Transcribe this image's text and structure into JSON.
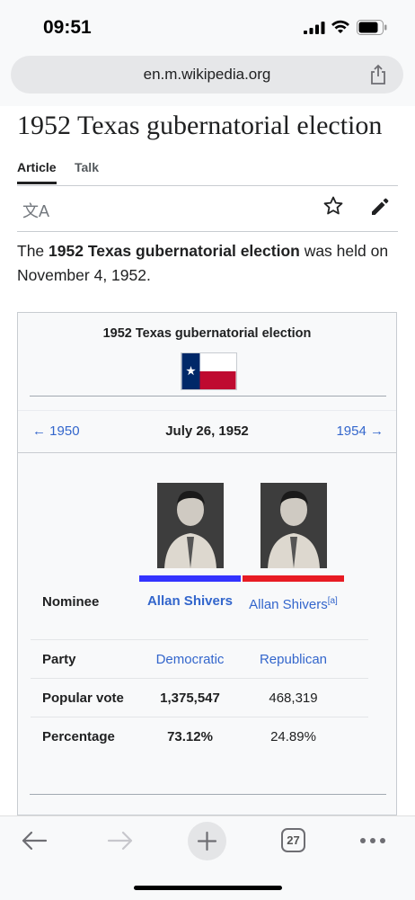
{
  "status_bar": {
    "time": "09:51"
  },
  "browser": {
    "url": "en.m.wikipedia.org"
  },
  "page": {
    "title": "1952 Texas gubernatorial election",
    "tabs": [
      "Article",
      "Talk"
    ],
    "lead": {
      "prefix": "The ",
      "bold": "1952 Texas gubernatorial election",
      "suffix": " was held on November 4, 1952."
    }
  },
  "infobox": {
    "title": "1952 Texas gubernatorial election",
    "prev": "← 1950",
    "date": "July 26, 1952",
    "next": "1954 →",
    "rows": {
      "nominee": {
        "label": "Nominee",
        "c1": "Allan Shivers",
        "c2": "Allan Shivers",
        "c2_note": "[a]"
      },
      "party": {
        "label": "Party",
        "c1": "Democratic",
        "c2": "Republican"
      },
      "popular_vote": {
        "label": "Popular vote",
        "c1": "1,375,547",
        "c2": "468,319"
      },
      "percentage": {
        "label": "Percentage",
        "c1": "73.12%",
        "c2": "24.89%"
      }
    },
    "colors": {
      "democratic": "#3333ff",
      "republican": "#e81b23"
    }
  },
  "toolbar": {
    "tab_count": "27"
  }
}
